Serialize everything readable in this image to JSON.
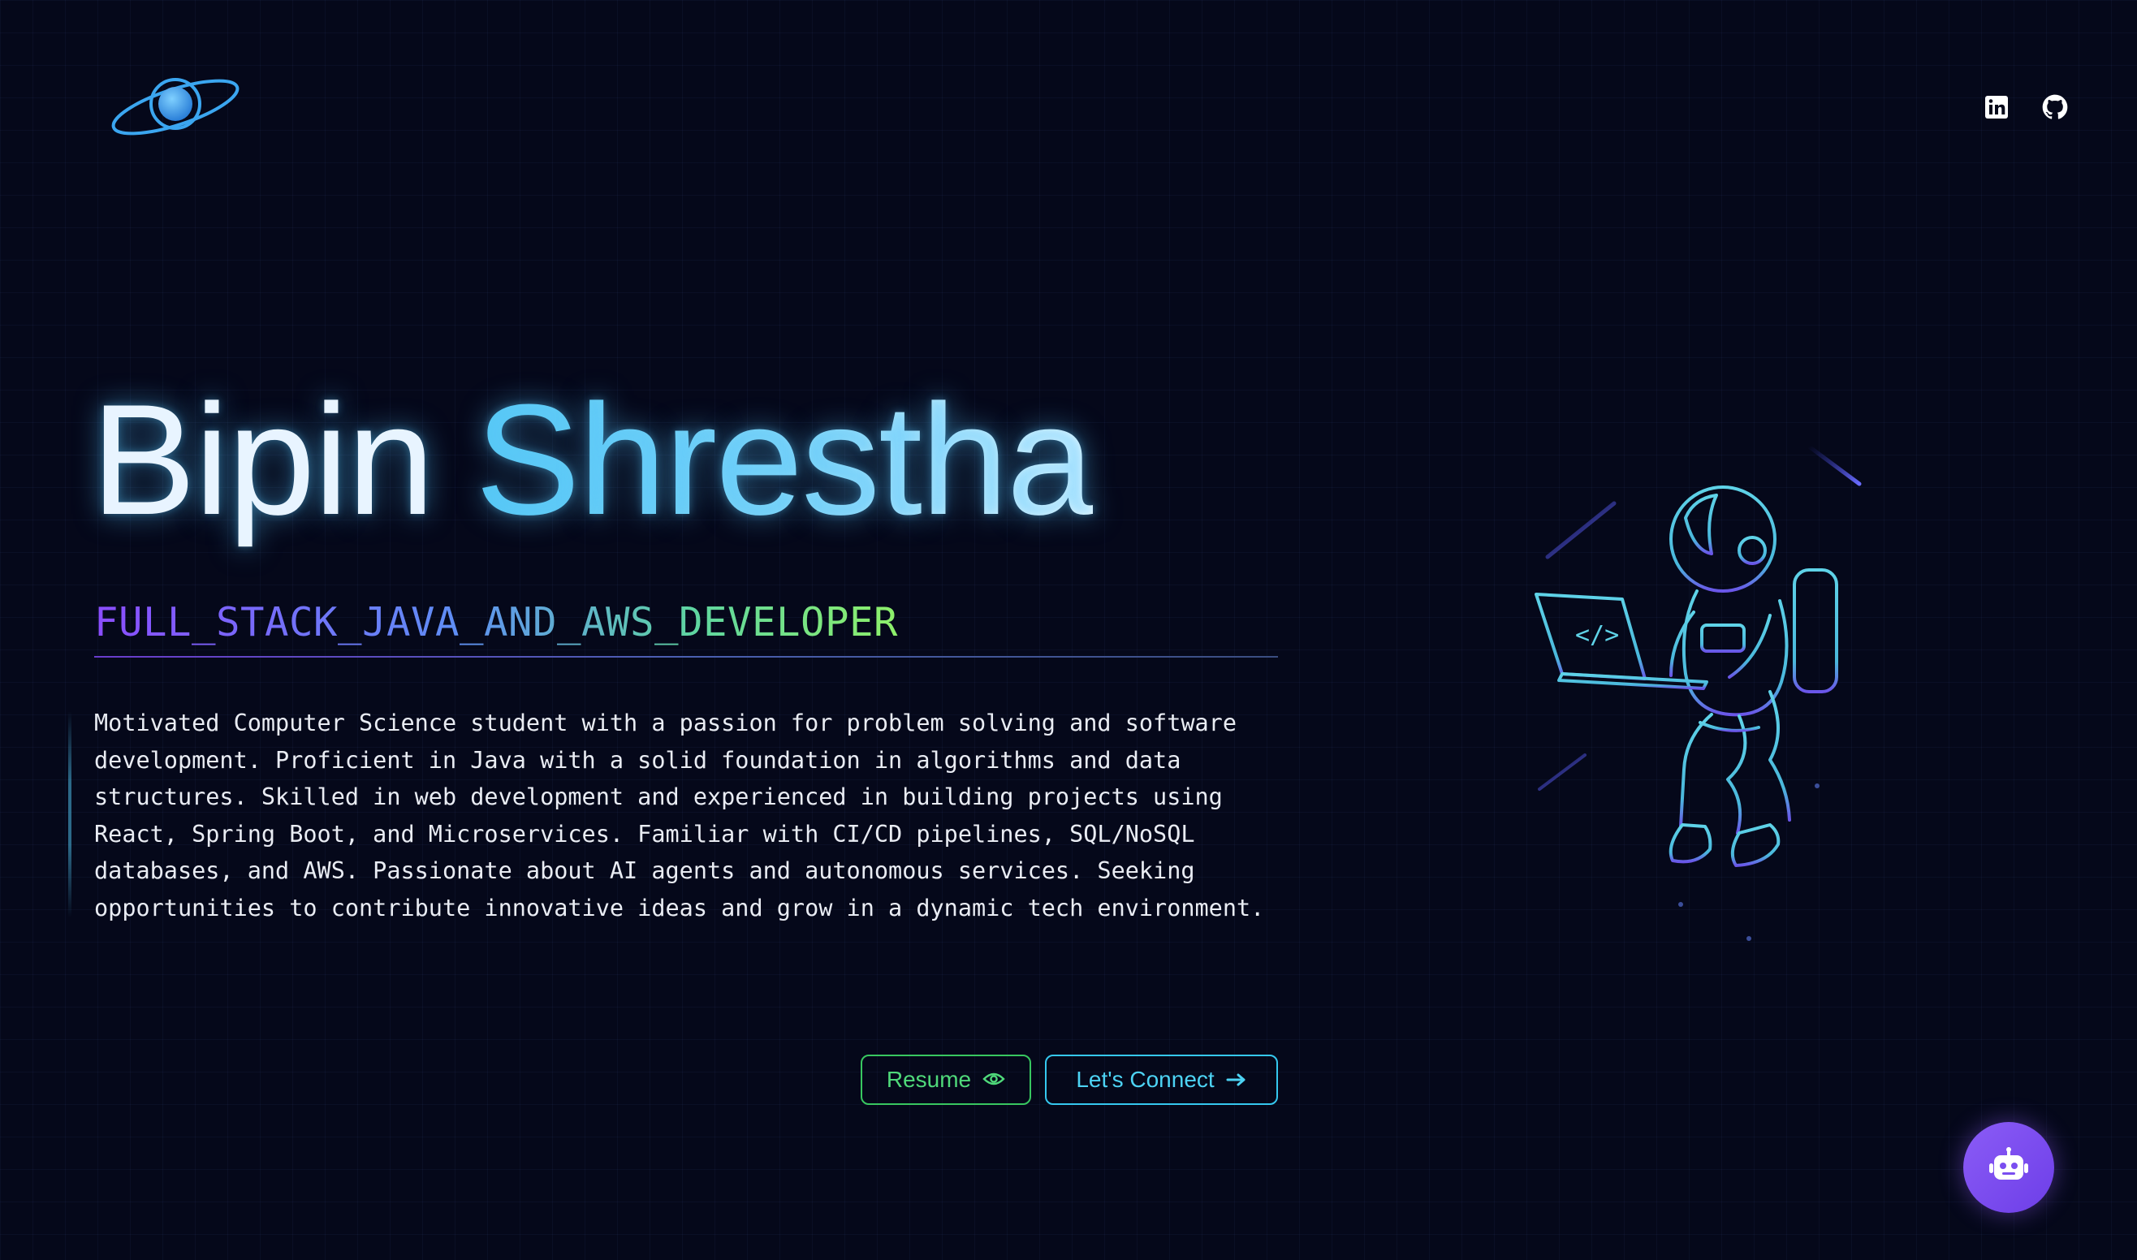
{
  "header": {
    "logo_icon": "planet-logo-icon",
    "social": [
      {
        "icon": "linkedin-icon"
      },
      {
        "icon": "github-icon"
      }
    ]
  },
  "hero": {
    "first_name": "Bipin",
    "last_name": "Shrestha",
    "role": "FULL_STACK_JAVA_AND_AWS_DEVELOPER",
    "description": "Motivated Computer Science student with a passion for problem solving and software development. Proficient in Java with a solid foundation in algorithms and data structures. Skilled in web development and experienced in building projects using React, Spring Boot, and Microservices. Familiar with CI/CD pipelines, SQL/NoSQL databases, and AWS. Passionate about AI agents and autonomous services. Seeking opportunities to contribute innovative ideas and grow in a dynamic tech environment."
  },
  "buttons": {
    "resume_label": "Resume",
    "resume_icon": "eye-icon",
    "connect_label": "Let's Connect",
    "connect_icon": "arrow-right-icon"
  },
  "illustration": {
    "icon": "astronaut-with-laptop-illustration",
    "laptop_glyph": "</>"
  },
  "chatbot": {
    "icon": "robot-icon"
  },
  "colors": {
    "background": "#05081a",
    "accent_cyan": "#4dd3f4",
    "accent_green": "#4fd97a",
    "accent_purple": "#8b5cf6"
  }
}
